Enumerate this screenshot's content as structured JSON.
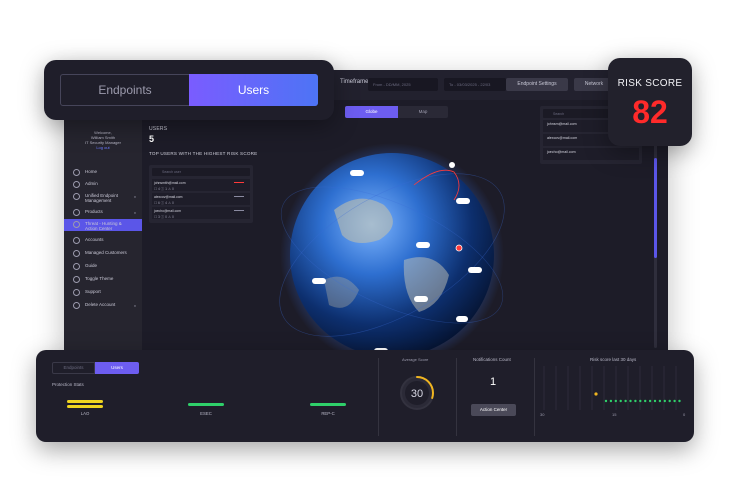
{
  "top_toggle": {
    "tab_endpoints": "Endpoints",
    "tab_users": "Users",
    "active": "Users"
  },
  "risk_score": {
    "label": "RISK SCORE",
    "value": "82",
    "value_color": "#ff2a2a"
  },
  "topbar": {
    "timeframe_label": "Timeframe",
    "from_placeholder": "From - DD/MM, 2025",
    "to_placeholder": "To - 03/03/2025 - 22/03",
    "endpoint_settings": "Endpoint Settings",
    "network": "Network"
  },
  "sidebar": {
    "welcome": "Welcome,",
    "user_name": "William Smith",
    "user_role": "IT Security Manager",
    "logout": "Log out",
    "items": [
      {
        "label": "Home",
        "icon": "home-icon"
      },
      {
        "label": "Admin",
        "icon": "admin-icon"
      },
      {
        "label": "Unified Endpoint Management",
        "icon": "endpoint-icon",
        "chevron": "v"
      },
      {
        "label": "Products",
        "icon": "shield-icon",
        "chevron": "v"
      },
      {
        "label": "Threat - Hunting & Action Center",
        "icon": "globe-icon",
        "active": true
      },
      {
        "label": "Accounts",
        "icon": "accounts-icon"
      },
      {
        "label": "Managed Customers",
        "icon": "customers-icon"
      },
      {
        "label": "Guide",
        "icon": "guide-icon"
      },
      {
        "label": "Toggle Theme",
        "icon": "theme-icon"
      },
      {
        "label": "Support",
        "icon": "support-icon"
      },
      {
        "label": "Delete Account",
        "icon": "delete-icon",
        "chevron": "v"
      }
    ]
  },
  "main": {
    "users_label": "USERS",
    "users_count": "5",
    "top_users_title": "TOP USERS WITH THE HIGHEST RISK SCORE",
    "search_placeholder": "Search user",
    "users": [
      {
        "email": "johnsmith@mail.com",
        "meta": "☐ 4   ⓘ 1   ⚠ 0"
      },
      {
        "email": "alexcov@mail.com",
        "meta": "☐ 6   ⓘ 4   ⚠ 0"
      },
      {
        "email": "joecho@mail.com",
        "meta": "☐ 3   ⓘ 0   ⚠ 0"
      }
    ],
    "view_toggle": {
      "globe": "Globe",
      "map": "Map",
      "active": "Globe"
    }
  },
  "right_panel": {
    "search_placeholder": "Search",
    "rows": [
      {
        "email": "johnsm@mail.com",
        "value": "0"
      },
      {
        "email": "alexcov@mail.com",
        "value": "0"
      },
      {
        "email": "joecho@mail.com",
        "value": "0"
      }
    ]
  },
  "bottom": {
    "toggle_endpoints": "Endpoints",
    "toggle_users": "Users",
    "protection_label": "Protection Stats",
    "protection": [
      {
        "name": "LAO",
        "color": "#f0d520"
      },
      {
        "name": "ESEC",
        "color": "#2fd06a"
      },
      {
        "name": "REP-C",
        "color": "#2fd06a"
      }
    ],
    "gauge_label": "Average Score",
    "gauge_value": "30",
    "gauge_fraction": 0.3,
    "notifications_label": "Notifications Count",
    "notifications_count": "1",
    "action_center": "Action Center",
    "trend_label": "Risk score last 30 days",
    "trend_ticks": [
      "30",
      "15",
      "0"
    ],
    "trend_points": 16
  }
}
